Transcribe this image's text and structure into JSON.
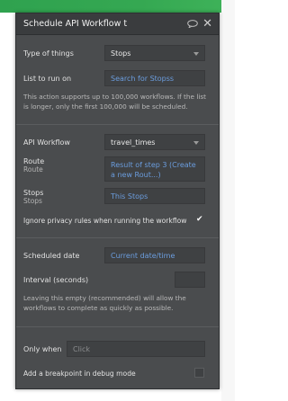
{
  "header": {
    "title": "Schedule API Workflow t",
    "comment_icon": "speech-bubble-icon",
    "close_icon": "close-icon"
  },
  "type_of_things": {
    "label": "Type of things",
    "value": "Stops"
  },
  "list_to_run_on": {
    "label": "List to run on",
    "value": "Search for Stopss"
  },
  "limit_note": "This action supports up to 100,000 workflows. If the list is longer, only the first 100,000 will be scheduled.",
  "api_workflow": {
    "label": "API Workflow",
    "value": "travel_times"
  },
  "route": {
    "label": "Route",
    "sublabel": "Route",
    "value": "Result of step 3 (Create a new Rout...)"
  },
  "stops": {
    "label": "Stops",
    "sublabel": "Stops",
    "value": "This Stops"
  },
  "ignore_privacy": {
    "label": "Ignore privacy rules when running the workflow",
    "checked": true
  },
  "scheduled_date": {
    "label": "Scheduled date",
    "value": "Current date/time"
  },
  "interval": {
    "label": "Interval (seconds)",
    "value": ""
  },
  "interval_note": "Leaving this empty (recommended) will allow the workflows to complete as quickly as possible.",
  "only_when": {
    "label": "Only when",
    "placeholder": "Click"
  },
  "breakpoint": {
    "label": "Add a breakpoint in debug mode",
    "checked": false
  },
  "colors": {
    "panel_bg": "#4a4c4e",
    "header_bg": "#3a3c3e",
    "link": "#6b9dde",
    "green": "#35a852"
  }
}
